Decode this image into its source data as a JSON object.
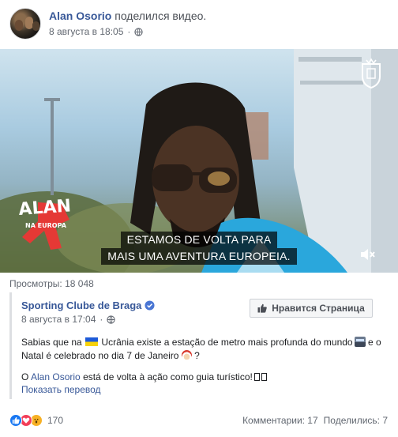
{
  "post": {
    "author": "Alan Osorio",
    "action": "поделился видео.",
    "date": "8 августа в 18:05",
    "privacy_icon": "globe-icon"
  },
  "video": {
    "subtitle_line1": "ESTAMOS DE VOLTA PARA",
    "subtitle_line2": "MAIS UMA AVENTURA EUROPEIA.",
    "logo_text_1": "ALAN",
    "logo_text_2": "NA EUROPA",
    "mute_icon": "volume-muted-icon"
  },
  "views": "Просмотры: 18 048",
  "shared": {
    "page_name": "Sporting Clube de Braga",
    "date": "8 августа в 17:04",
    "like_page_label": "Нравится Страница",
    "text_a": "Sabias que na",
    "text_b": "Ucrânia existe a estação de metro mais profunda do mundo",
    "text_c": "e o Natal é celebrado no dia 7 de Janeiro",
    "text_d": "?",
    "p2_a": "O",
    "p2_link": "Alan Osorio",
    "p2_b": "está de volta à ação como guia turístico!",
    "translate": "Показать перевод"
  },
  "footer": {
    "reaction_count": "170",
    "comments": "Комментарии: 17",
    "shares": "Поделились: 7"
  },
  "colors": {
    "link": "#385898",
    "like": "#1877f2",
    "love": "#f33e58",
    "wow": "#f7b125"
  }
}
